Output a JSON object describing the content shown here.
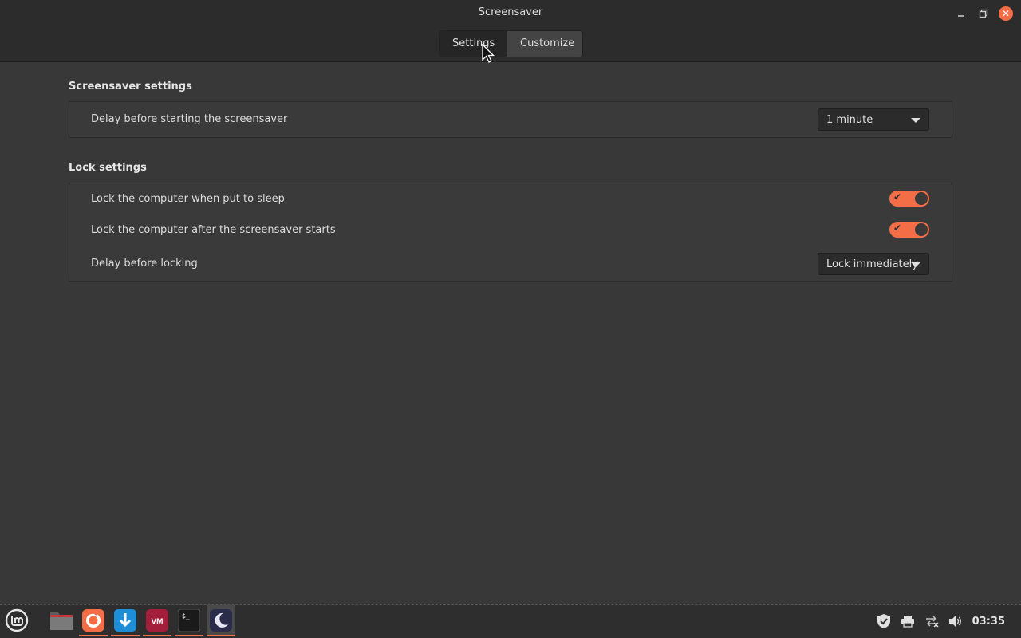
{
  "window": {
    "title": "Screensaver"
  },
  "tabs": [
    {
      "label": "Settings",
      "active": true
    },
    {
      "label": "Customize",
      "active": false
    }
  ],
  "screensaver_settings": {
    "title": "Screensaver settings",
    "delay_label": "Delay before starting the screensaver",
    "delay_value": "1 minute"
  },
  "lock_settings": {
    "title": "Lock settings",
    "rows": [
      {
        "label": "Lock the computer when put to sleep",
        "enabled": true
      },
      {
        "label": "Lock the computer after the screensaver starts",
        "enabled": true
      }
    ],
    "lock_delay_label": "Delay before locking",
    "lock_delay_value": "Lock immediately"
  },
  "taskbar": {
    "apps": [
      {
        "name": "files-icon",
        "running": false
      },
      {
        "name": "firefox-icon",
        "running": true
      },
      {
        "name": "update-manager-icon",
        "running": true
      },
      {
        "name": "vmware-icon",
        "running": true
      },
      {
        "name": "terminal-icon",
        "running": true
      },
      {
        "name": "screensaver-icon",
        "running": true,
        "active": true
      }
    ],
    "clock": "03:35"
  },
  "colors": {
    "accent": "#f36d46",
    "background": "#383838",
    "header": "#2c2c2c"
  }
}
